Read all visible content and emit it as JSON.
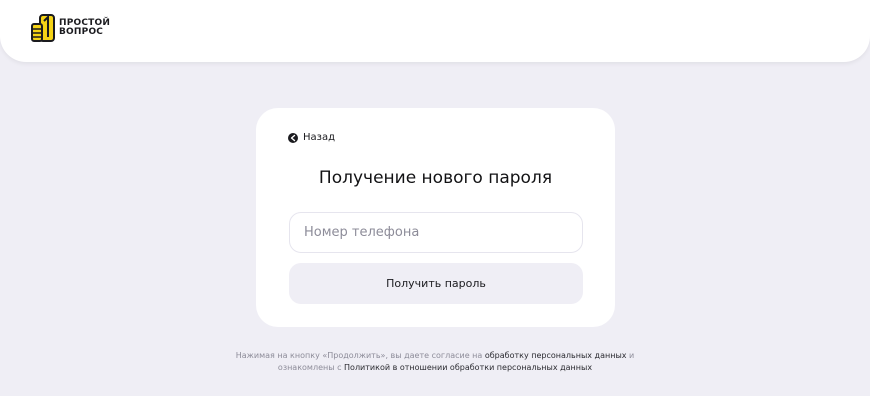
{
  "header": {
    "logo": {
      "line1": "ПРОСТОЙ",
      "line2": "ВОПРОС",
      "icon": "thumbs-up-logo-icon"
    }
  },
  "card": {
    "back": {
      "label": "Назад",
      "icon": "arrow-left-icon"
    },
    "title": "Получение нового пароля",
    "phone": {
      "placeholder": "Номер телефона",
      "value": ""
    },
    "submit_label": "Получить пароль"
  },
  "footer": {
    "consent_text_1": "Нажимая на кнопку «Продолжить», вы даете согласие на ",
    "consent_link_1": "обработку персональных данных",
    "consent_text_2": " и",
    "consent_text_3": "ознакомлены с ",
    "consent_link_2": "Политикой в отношении обработки персональных данных"
  },
  "colors": {
    "page_background": "#efeef5",
    "card_background": "#ffffff",
    "brand_yellow": "#f5d316",
    "button_background": "#efeef5"
  }
}
